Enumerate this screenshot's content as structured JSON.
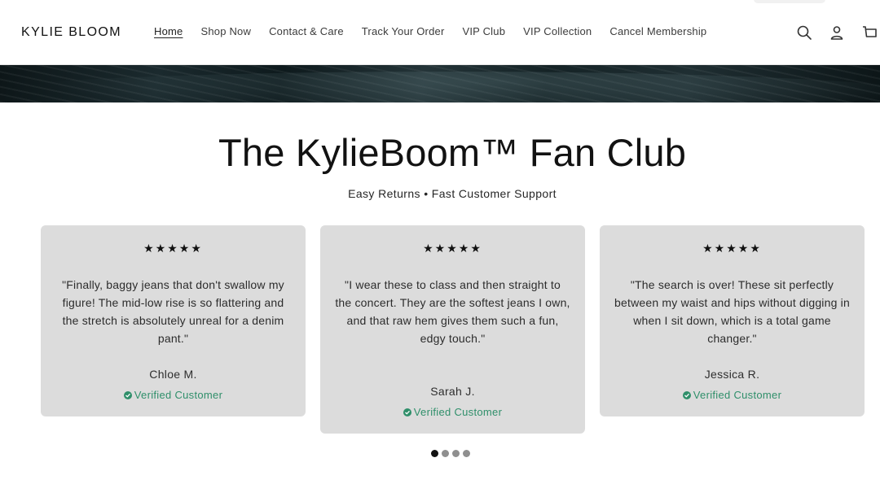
{
  "header": {
    "logo": "KYLIE BLOOM",
    "nav": [
      {
        "label": "Home",
        "active": true
      },
      {
        "label": "Shop Now"
      },
      {
        "label": "Contact & Care"
      },
      {
        "label": "Track Your Order"
      },
      {
        "label": "VIP Club"
      },
      {
        "label": "VIP Collection"
      },
      {
        "label": "Cancel Membership"
      }
    ],
    "icons": [
      "search-icon",
      "account-icon",
      "cart-icon"
    ]
  },
  "section": {
    "title": "The KylieBoom™ Fan Club",
    "subtitle": "Easy Returns • Fast Customer Support"
  },
  "reviews": [
    {
      "stars": "★★★★★",
      "rating": 5,
      "quote": "\"Finally, baggy jeans that don't swallow my figure! The mid-low rise is so flattering and the stretch is absolutely unreal for a denim pant.\"",
      "name": "Chloe M.",
      "verified": "Verified Customer"
    },
    {
      "stars": "★★★★★",
      "rating": 5,
      "quote": "\"I wear these to class and then straight to the concert. They are the softest jeans I own, and that raw hem gives them such a fun, edgy touch.\"",
      "name": "Sarah J.",
      "verified": "Verified Customer"
    },
    {
      "stars": "★★★★★",
      "rating": 4.5,
      "quote": "\"The search is over! These sit perfectly between my waist and hips without digging in when I sit down, which is a total game changer.\"",
      "name": "Jessica R.",
      "verified": "Verified Customer"
    }
  ],
  "carousel": {
    "pages": 4,
    "active_index": 0
  },
  "colors": {
    "card_bg": "#dcdcdc",
    "verified_green": "#2f8f6a",
    "banner": "#1b2a2e"
  }
}
